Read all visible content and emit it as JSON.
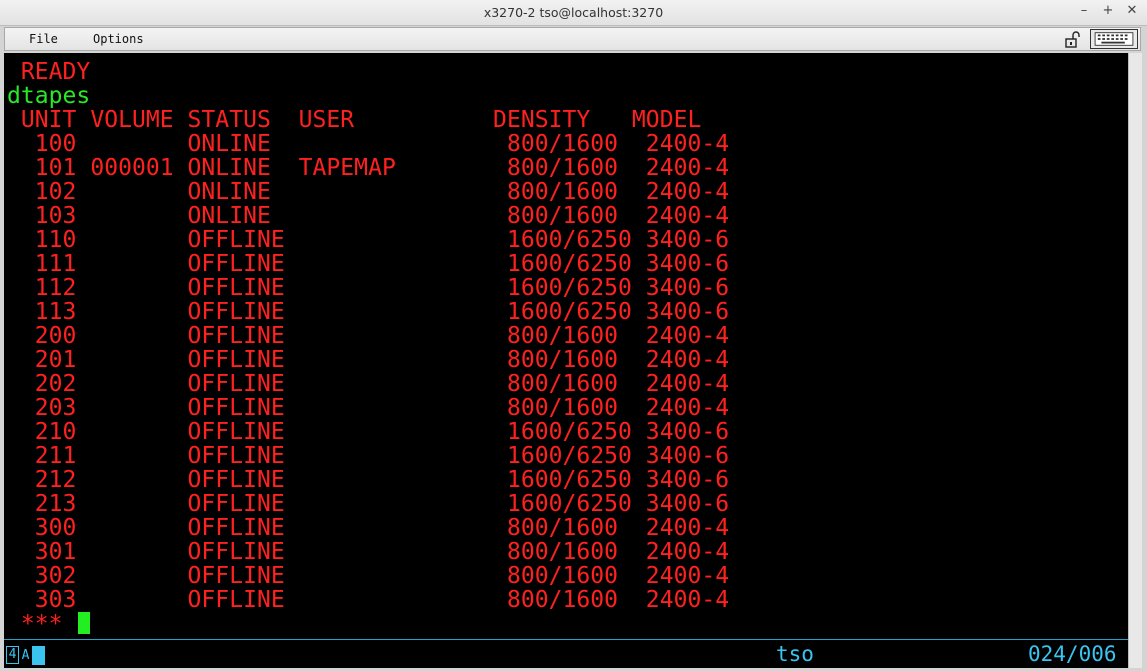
{
  "window": {
    "title": "x3270-2 tso@localhost:3270"
  },
  "window_controls": {
    "minimize": "–",
    "maximize": "+",
    "close": "✕"
  },
  "menu": {
    "file": "File",
    "options": "Options"
  },
  "terminal": {
    "ready": " READY",
    "command": "dtapes",
    "header": " UNIT VOLUME STATUS  USER          DENSITY   MODEL",
    "rows": [
      "  100        ONLINE                 800/1600  2400-4",
      "  101 000001 ONLINE  TAPEMAP        800/1600  2400-4",
      "  102        ONLINE                 800/1600  2400-4",
      "  103        ONLINE                 800/1600  2400-4",
      "  110        OFFLINE                1600/6250 3400-6",
      "  111        OFFLINE                1600/6250 3400-6",
      "  112        OFFLINE                1600/6250 3400-6",
      "  113        OFFLINE                1600/6250 3400-6",
      "  200        OFFLINE                800/1600  2400-4",
      "  201        OFFLINE                800/1600  2400-4",
      "  202        OFFLINE                800/1600  2400-4",
      "  203        OFFLINE                800/1600  2400-4",
      "  210        OFFLINE                1600/6250 3400-6",
      "  211        OFFLINE                1600/6250 3400-6",
      "  212        OFFLINE                1600/6250 3400-6",
      "  213        OFFLINE                1600/6250 3400-6",
      "  300        OFFLINE                800/1600  2400-4",
      "  301        OFFLINE                800/1600  2400-4",
      "  302        OFFLINE                800/1600  2400-4",
      "  303        OFFLINE                800/1600  2400-4"
    ],
    "prompt": " ***"
  },
  "status_line": {
    "indicator_4": "4",
    "indicator_a": "A",
    "luname": "tso",
    "cursor_position": "024/006"
  },
  "colors": {
    "screen_bg": "#000000",
    "output_text": "#ff2020",
    "input_text": "#28e828",
    "status_text": "#39c5f0"
  }
}
